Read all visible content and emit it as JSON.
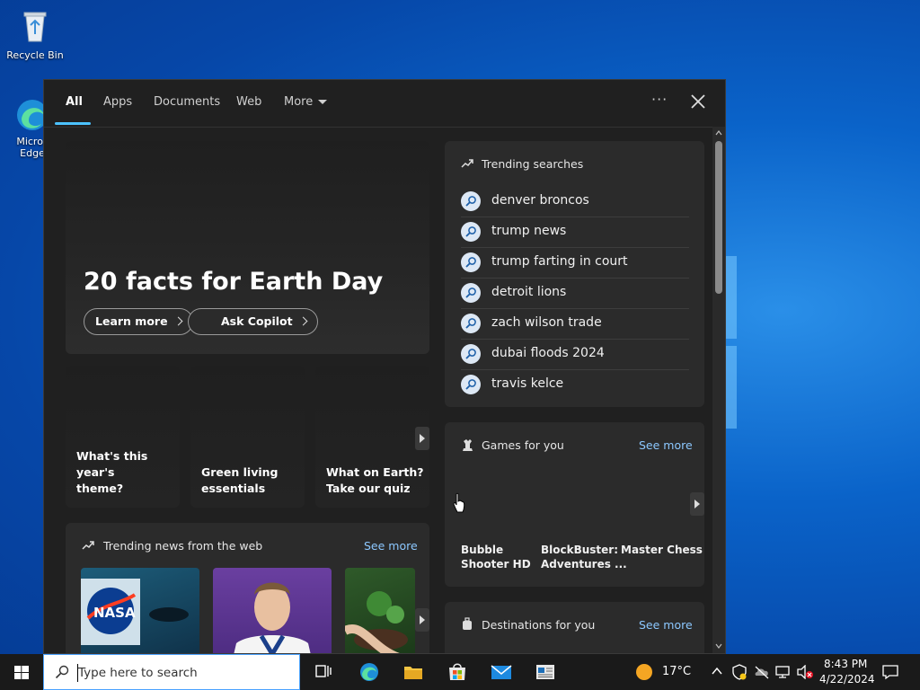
{
  "desktop": {
    "recycle_bin": "Recycle Bin",
    "edge_line1": "Micros",
    "edge_line2": "Edge"
  },
  "panel": {
    "tabs": [
      "All",
      "Apps",
      "Documents",
      "Web",
      "More"
    ],
    "hero": {
      "title": "20 facts for Earth Day",
      "learn_more": "Learn more",
      "ask_copilot": "Ask Copilot"
    },
    "cards": [
      {
        "line1": "What's this year's",
        "line2": "theme?"
      },
      {
        "line1": "Green living",
        "line2": "essentials"
      },
      {
        "line1": "What on Earth?",
        "line2": "Take our quiz"
      }
    ],
    "news": {
      "title": "Trending news from the web",
      "see_more": "See more"
    },
    "trending": {
      "title": "Trending searches",
      "items": [
        "denver broncos",
        "trump news",
        "trump farting in court",
        "detroit lions",
        "zach wilson trade",
        "dubai floods 2024",
        "travis kelce"
      ]
    },
    "games": {
      "title": "Games for you",
      "see_more": "See more",
      "items": [
        {
          "line1": "Bubble",
          "line2": "Shooter HD"
        },
        {
          "line1": "BlockBuster:",
          "line2": "Adventures ..."
        },
        {
          "line1": "Master Chess",
          "line2": ""
        }
      ]
    },
    "destinations": {
      "title": "Destinations for you",
      "see_more": "See more"
    }
  },
  "taskbar": {
    "search_placeholder": "Type here to search",
    "temperature": "17°C",
    "time": "8:43 PM",
    "date": "4/22/2024"
  },
  "colors": {
    "accent": "#4cc2ff",
    "link": "#8cc8ff",
    "panel_bg": "#202020",
    "card_bg": "#2b2b2b"
  }
}
